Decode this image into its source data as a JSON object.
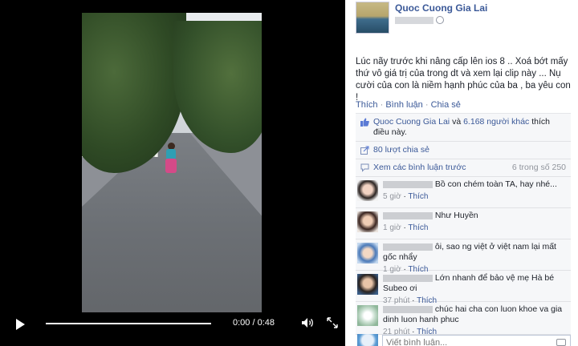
{
  "video": {
    "time": "0:00 / 0:48",
    "progress": 0
  },
  "post": {
    "author": "Quoc Cuong Gia Lai",
    "text": "Lúc nãy trước khi nâng cấp lên ios 8 .. Xoá bớt mấy thứ vô giá trị của trong dt và xem lại clip này ... Nụ cười của con là niềm hạnh phúc của ba , ba yêu con !",
    "actions": {
      "like": "Thích",
      "comment": "Bình luận",
      "share": "Chia sẻ",
      "separator": "·"
    }
  },
  "feedback": {
    "likes": {
      "name": "Quoc Cuong Gia Lai",
      "conjunction": " và ",
      "others": "6.168 người khác",
      "suffix": " thích điều này."
    },
    "shares": "80 lượt chia sẻ",
    "previous_comments": "Xem các bình luận trước",
    "comment_count": "6 trong số 250"
  },
  "comments": [
    {
      "text": "Bồ con chém toàn TA, hay nhé...",
      "time": "5 giờ",
      "like": "Thích"
    },
    {
      "text": "Như Huyền",
      "time": "1 giờ",
      "like": "Thích"
    },
    {
      "text": "ôi, sao ng việt ở việt nam lại mất gốc nhẩy",
      "time": "1 giờ",
      "like": "Thích"
    },
    {
      "text": "Lớn nhanh để bảo vệ mẹ Hà bé Subeo ơi",
      "time": "37 phút",
      "like": "Thích"
    },
    {
      "text": "chúc hai cha con luon khoe va gia dinh luon hanh phuc",
      "time": "21 phút",
      "like": "Thích"
    }
  ],
  "composer": {
    "placeholder": "Viết bình luận..."
  },
  "colors": {
    "link": "#3b5998",
    "muted": "#90949c",
    "feedback_bg": "#f6f7f9"
  },
  "icons": [
    "play-icon",
    "volume-icon",
    "fullscreen-icon",
    "globe-icon",
    "thumbs-up-icon",
    "share-icon",
    "comment-bubble-icon",
    "camera-icon"
  ]
}
